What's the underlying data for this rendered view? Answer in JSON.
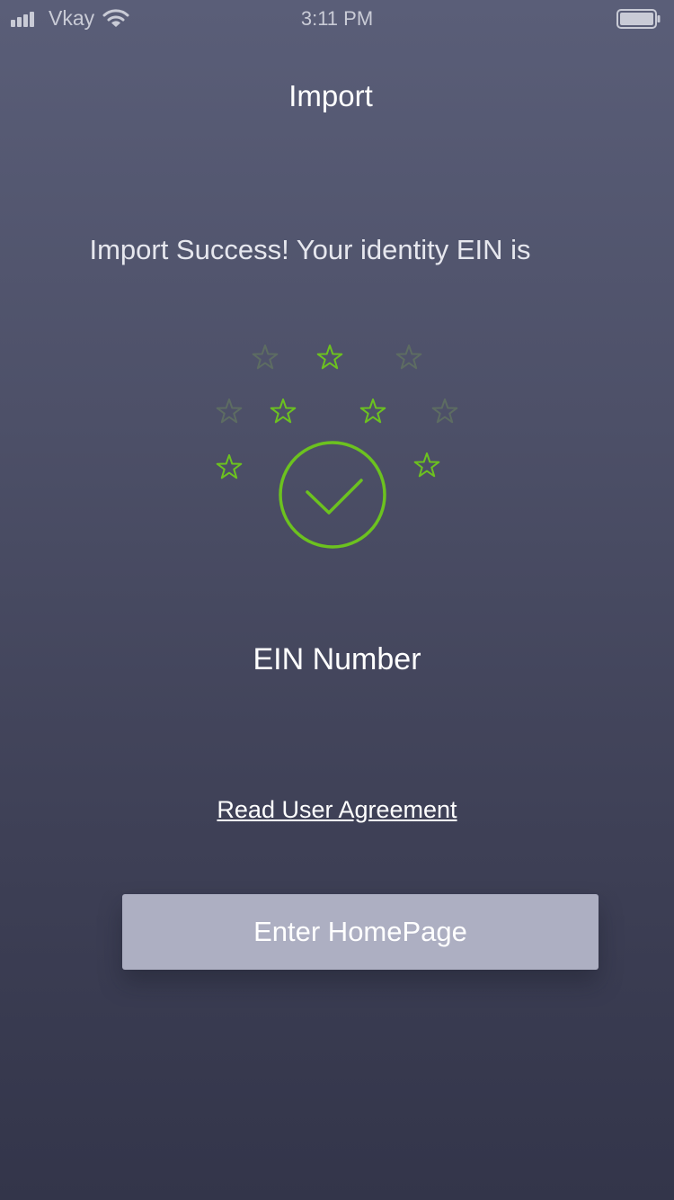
{
  "status_bar": {
    "carrier": "Vkay",
    "time": "3:11 PM",
    "icons": [
      "signal-icon",
      "wifi-icon",
      "battery-icon"
    ]
  },
  "nav": {
    "title": "Import"
  },
  "content": {
    "message": "Import Success! Your identity EIN is",
    "ein": "EIN Number",
    "agreement_link": "Read User Agreement"
  },
  "actions": {
    "enter_home_label": "Enter HomePage"
  },
  "colors": {
    "accent_green": "#6cc21f",
    "dim_star": "#5d6c62",
    "button_bg": "#adafc2",
    "background_top": "#5a5e78",
    "background_bottom": "#33354a"
  }
}
